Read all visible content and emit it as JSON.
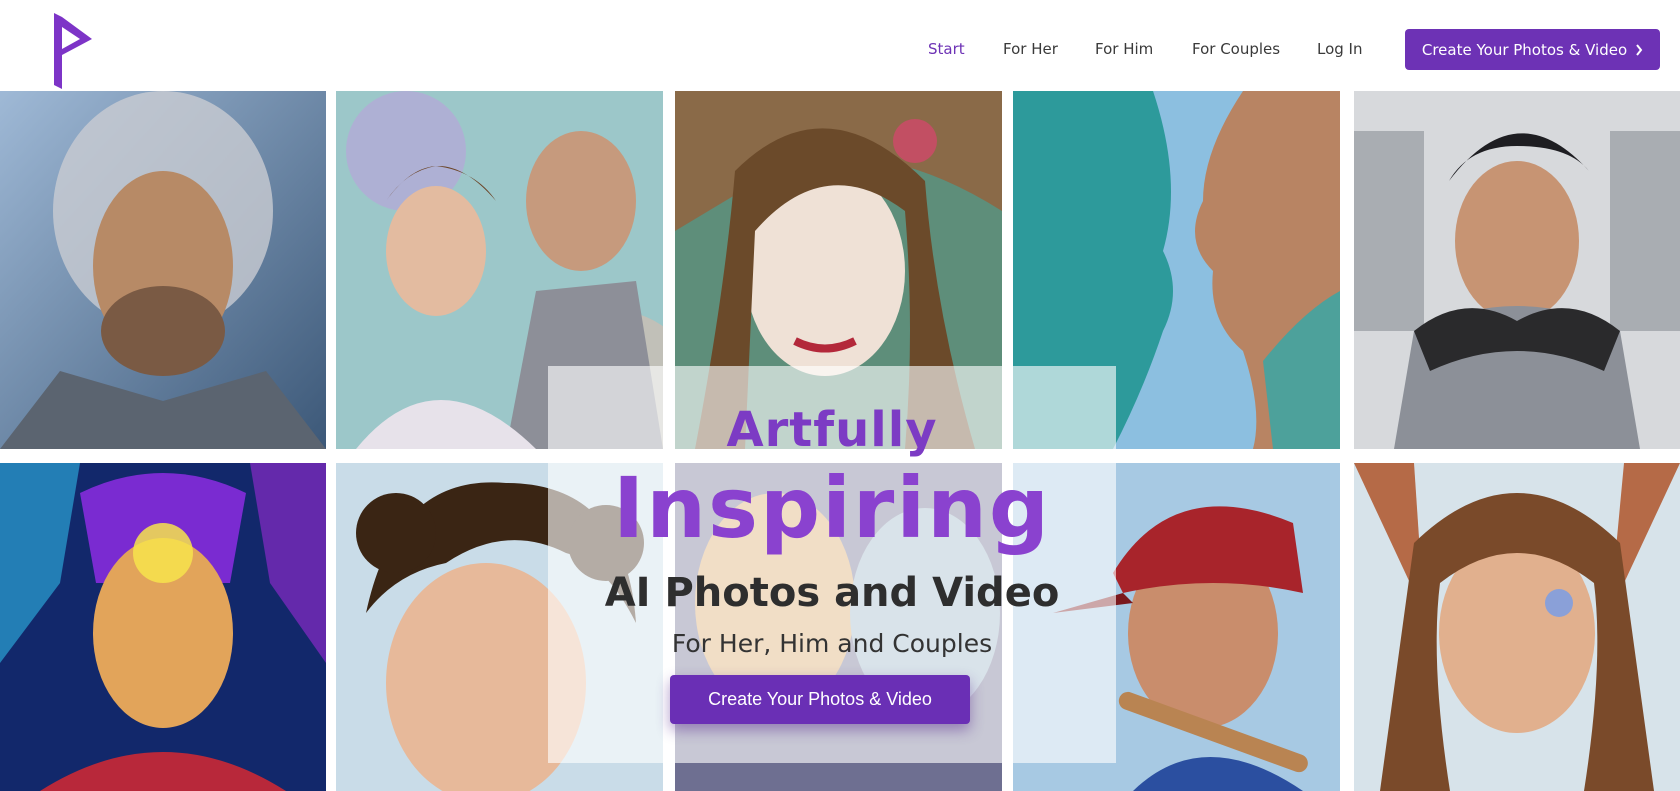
{
  "brand": {
    "logo_icon": "p-logo-icon",
    "accent_color": "#6d32b5"
  },
  "nav": {
    "items": [
      {
        "label": "Start",
        "active": true
      },
      {
        "label": "For Her",
        "active": false
      },
      {
        "label": "For Him",
        "active": false
      },
      {
        "label": "For Couples",
        "active": false
      },
      {
        "label": "Log In",
        "active": false
      }
    ],
    "cta_label": "Create Your Photos & Video",
    "cta_icon": "chevron-right-icon"
  },
  "gallery": {
    "tiles": [
      {
        "subject": "silver-haired-bearded-man-portrait"
      },
      {
        "subject": "couple-in-formal-wear-portrait"
      },
      {
        "subject": "woman-with-flower-crown-portrait"
      },
      {
        "subject": "teal-face-and-man-profile-portrait"
      },
      {
        "subject": "dark-haired-man-in-armor-portrait"
      },
      {
        "subject": "woman-in-neon-helmet-portrait"
      },
      {
        "subject": "curly-haired-young-man-portrait"
      },
      {
        "subject": "faces-behind-overlay-portrait"
      },
      {
        "subject": "baseball-player-portrait"
      },
      {
        "subject": "woman-with-fantasy-ears-portrait"
      }
    ]
  },
  "hero": {
    "line1": "Artfully",
    "line2": "Inspiring",
    "line3": "AI Photos and Video",
    "line4": "For Her, Him and Couples",
    "cta_label": "Create Your Photos & Video"
  }
}
